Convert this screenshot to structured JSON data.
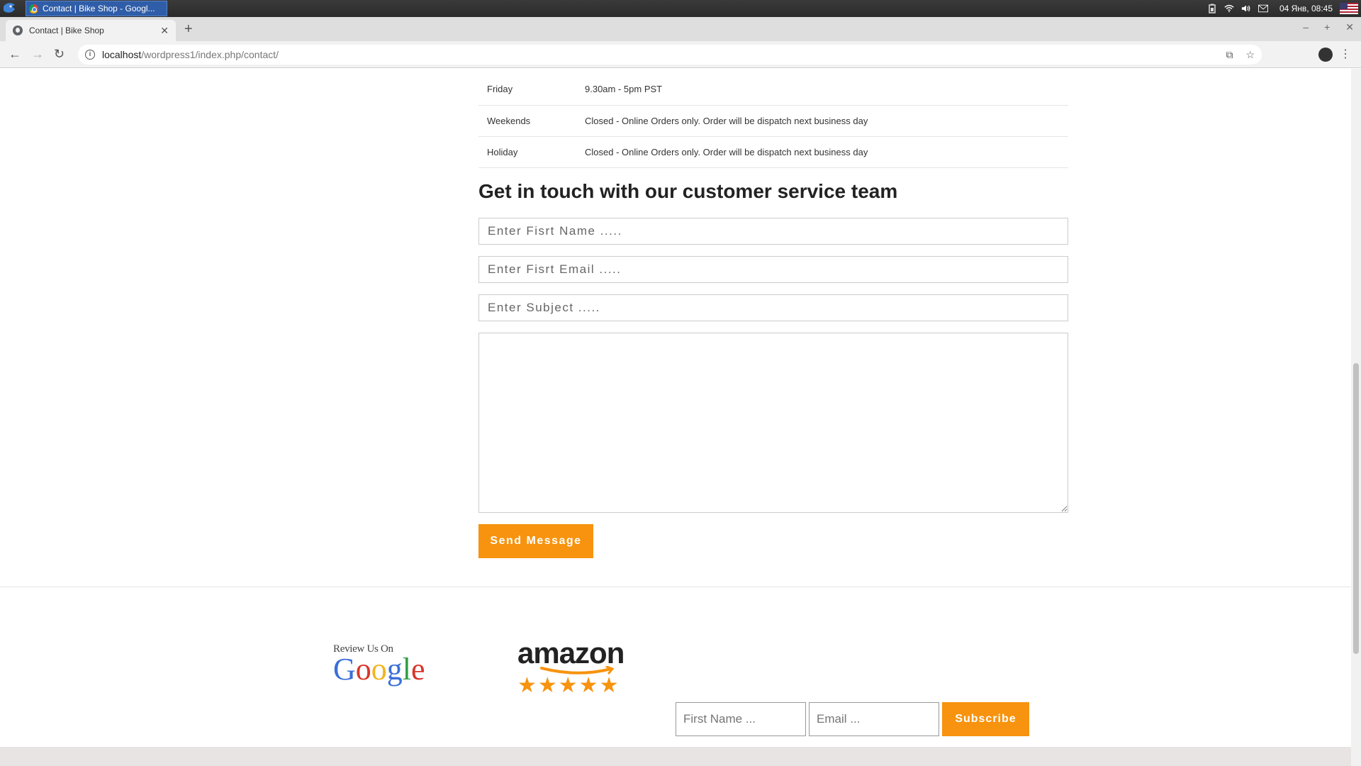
{
  "taskbar": {
    "task_title": "Contact | Bike Shop - Googl...",
    "clock": "04 Янв, 08:45"
  },
  "browser": {
    "tab_title": "Contact | Bike Shop",
    "url_host": "localhost",
    "url_path": "/wordpress1/index.php/contact/"
  },
  "hours": [
    {
      "day": "Friday",
      "time": "9.30am - 5pm PST"
    },
    {
      "day": "Weekends",
      "time": "Closed - Online Orders only. Order will be dispatch next business day"
    },
    {
      "day": "Holiday",
      "time": "Closed - Online Orders only. Order will be dispatch next business day"
    }
  ],
  "contact_form": {
    "heading": "Get in touch with our customer service team",
    "name_placeholder": "Enter Fisrt Name .....",
    "email_placeholder": "Enter Fisrt Email .....",
    "subject_placeholder": "Enter Subject .....",
    "send_label": "Send Message"
  },
  "footer": {
    "google_review_small": "Review Us On",
    "google_word": "Google",
    "amazon_word": "amazon",
    "amazon_stars": "★★★★★",
    "first_name_placeholder": "First Name ...",
    "email_placeholder": "Email ...",
    "subscribe_label": "Subscribe"
  },
  "colors": {
    "accent": "#f7930e",
    "taskbar": "#2b2b2b"
  }
}
